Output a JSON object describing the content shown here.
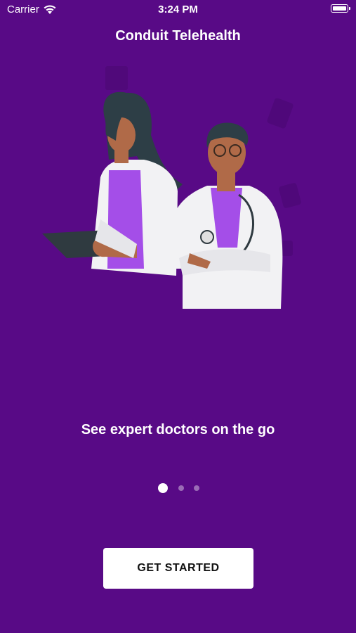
{
  "status_bar": {
    "carrier": "Carrier",
    "time": "3:24 PM",
    "wifi_icon": "wifi-icon",
    "battery_icon": "battery-full-icon"
  },
  "header": {
    "title": "Conduit Telehealth"
  },
  "onboarding": {
    "illustration": "two-doctors-illustration",
    "tagline": "See expert doctors on the go",
    "page_count": 3,
    "current_page": 1
  },
  "cta": {
    "label": "GET STARTED"
  },
  "colors": {
    "background": "#580a86",
    "accent_purple": "#a44ee8",
    "button_bg": "#ffffff",
    "button_text": "#111111"
  }
}
